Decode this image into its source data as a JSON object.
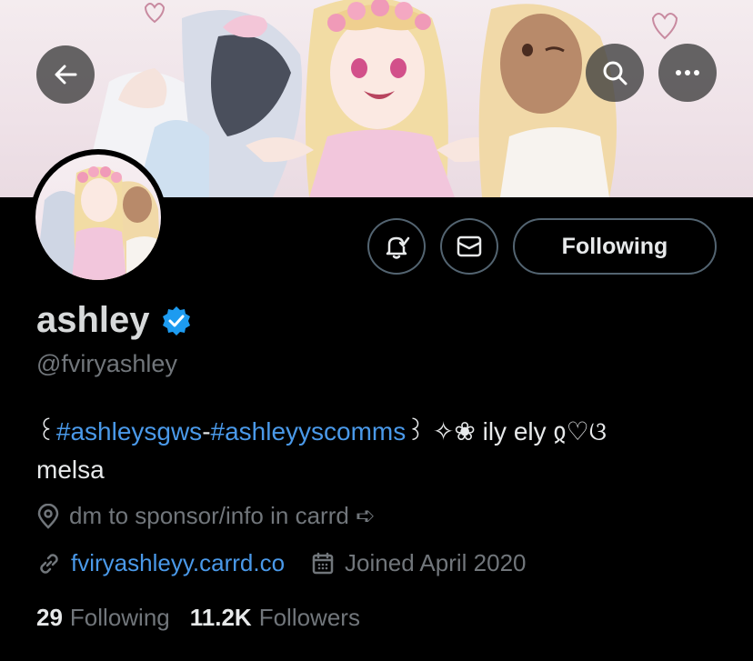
{
  "profile": {
    "name": "ashley",
    "handle": "@fviryashley",
    "bio_open": "꒰",
    "bio_tag1": "#ashleysgws",
    "bio_dash": "-",
    "bio_tag2": "#ashleyyscomms",
    "bio_rest": "꒱ ✧❀ ily ely ჲ♡ଓ",
    "bio_line2": "melsa",
    "location": "dm to sponsor/info in carrd ➪",
    "website": "fviryashleyy.carrd.co",
    "joined": "Joined April 2020",
    "following_count": "29",
    "following_label": "Following",
    "followers_count": "11.2K",
    "followers_label": "Followers"
  },
  "actions": {
    "follow_label": "Following"
  },
  "colors": {
    "accent": "#4a99e9",
    "verified": "#1d9bf0",
    "muted": "#71767b",
    "background": "#000000"
  },
  "icons": [
    "back-arrow-icon",
    "search-icon",
    "more-icon",
    "notification-bell-icon",
    "mail-icon",
    "verified-badge-icon",
    "location-pin-icon",
    "link-icon",
    "calendar-icon"
  ]
}
